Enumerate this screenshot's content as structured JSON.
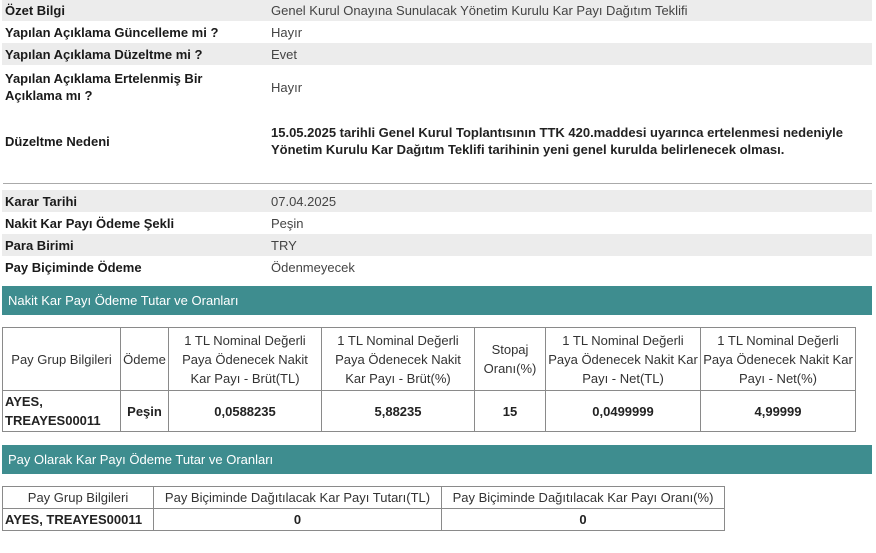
{
  "summary": {
    "rows": [
      {
        "label": "Özet Bilgi",
        "value": "Genel Kurul Onayına Sunulacak Yönetim Kurulu Kar Payı Dağıtım Teklifi"
      },
      {
        "label": "Yapılan Açıklama Güncelleme mi ?",
        "value": "Hayır"
      },
      {
        "label": "Yapılan Açıklama Düzeltme mi ?",
        "value": "Evet"
      },
      {
        "label": "Yapılan Açıklama Ertelenmiş Bir Açıklama mı ?",
        "value": "Hayır"
      },
      {
        "label": "Düzeltme Nedeni",
        "value": "15.05.2025 tarihli Genel Kurul Toplantısının TTK 420.maddesi uyarınca ertelenmesi nedeniyle Yönetim Kurulu Kar Dağıtım Teklifi tarihinin yeni genel kurulda belirlenecek olması."
      }
    ]
  },
  "decision": {
    "rows": [
      {
        "label": "Karar Tarihi",
        "value": "07.04.2025"
      },
      {
        "label": "Nakit Kar Payı Ödeme Şekli",
        "value": "Peşin"
      },
      {
        "label": "Para Birimi",
        "value": "TRY"
      },
      {
        "label": "Pay Biçiminde Ödeme",
        "value": "Ödenmeyecek"
      }
    ]
  },
  "cash_section": {
    "title": "Nakit Kar Payı Ödeme Tutar ve Oranları",
    "headers": [
      "Pay Grup Bilgileri",
      "Ödeme",
      "1 TL Nominal Değerli Paya Ödenecek Nakit Kar Payı - Brüt(TL)",
      "1 TL Nominal Değerli Paya Ödenecek Nakit Kar Payı - Brüt(%)",
      "Stopaj Oranı(%)",
      "1 TL Nominal Değerli Paya Ödenecek Nakit Kar Payı - Net(TL)",
      "1 TL Nominal Değerli Paya Ödenecek Nakit Kar Payı - Net(%)"
    ],
    "row": {
      "group": "AYES, TREAYES00011",
      "payment": "Peşin",
      "gross_tl": "0,0588235",
      "gross_pct": "5,88235",
      "withholding": "15",
      "net_tl": "0,0499999",
      "net_pct": "4,99999"
    }
  },
  "share_section": {
    "title": "Pay Olarak Kar Payı Ödeme Tutar ve Oranları",
    "headers": [
      "Pay Grup Bilgileri",
      "Pay Biçiminde Dağıtılacak Kar Payı Tutarı(TL)",
      "Pay Biçiminde Dağıtılacak Kar Payı Oranı(%)"
    ],
    "row": {
      "group": "AYES, TREAYES00011",
      "amount": "0",
      "rate": "0"
    }
  },
  "colors": {
    "section_header": "#3e8d8f",
    "row_shade": "#ececec"
  }
}
